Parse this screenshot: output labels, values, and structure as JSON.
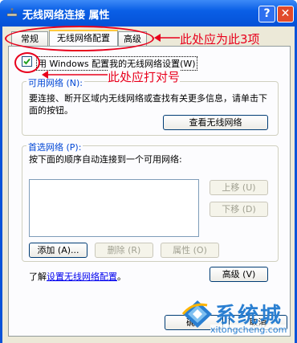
{
  "window": {
    "title": "无线网络连接 属性"
  },
  "titlebar_buttons": {
    "help": "?",
    "close": "✕"
  },
  "tabs": [
    {
      "label": "常规"
    },
    {
      "label": "无线网络配置"
    },
    {
      "label": "高级"
    }
  ],
  "checkbox": {
    "label": "用 Windows 配置我的无线网络设置(W)",
    "checked": true
  },
  "available": {
    "label": "可用网络 (N):",
    "description": "要连接、断开区域内无线网络或查找有关更多信息，请单击下面的按钮。",
    "view_button": "查看无线网络"
  },
  "preferred": {
    "label": "首选网络 (P):",
    "description": "按下面的顺序自动连接到一个可用网络:",
    "up_button": "上移 (U)",
    "down_button": "下移 (D)",
    "add_button": "添加 (A)...",
    "remove_button": "删除 (R)",
    "properties_button": "属性 (O)"
  },
  "learn": {
    "prefix": "了解",
    "link": "设置无线网络配置",
    "suffix": "。"
  },
  "advanced_button": "高级 (V)",
  "footer": {
    "ok_partial": "确",
    "cancel": "取消"
  },
  "annotations": {
    "tabs_note": "此处应为此3项",
    "check_note": "此处应打对号"
  },
  "watermark": {
    "name": "系统城",
    "url": "xitongcheng.com"
  },
  "colors": {
    "titlebar": "#0a5fe6",
    "dialog_bg": "#ece9d8",
    "annotation": "#e8001c",
    "link": "#0000ee"
  }
}
